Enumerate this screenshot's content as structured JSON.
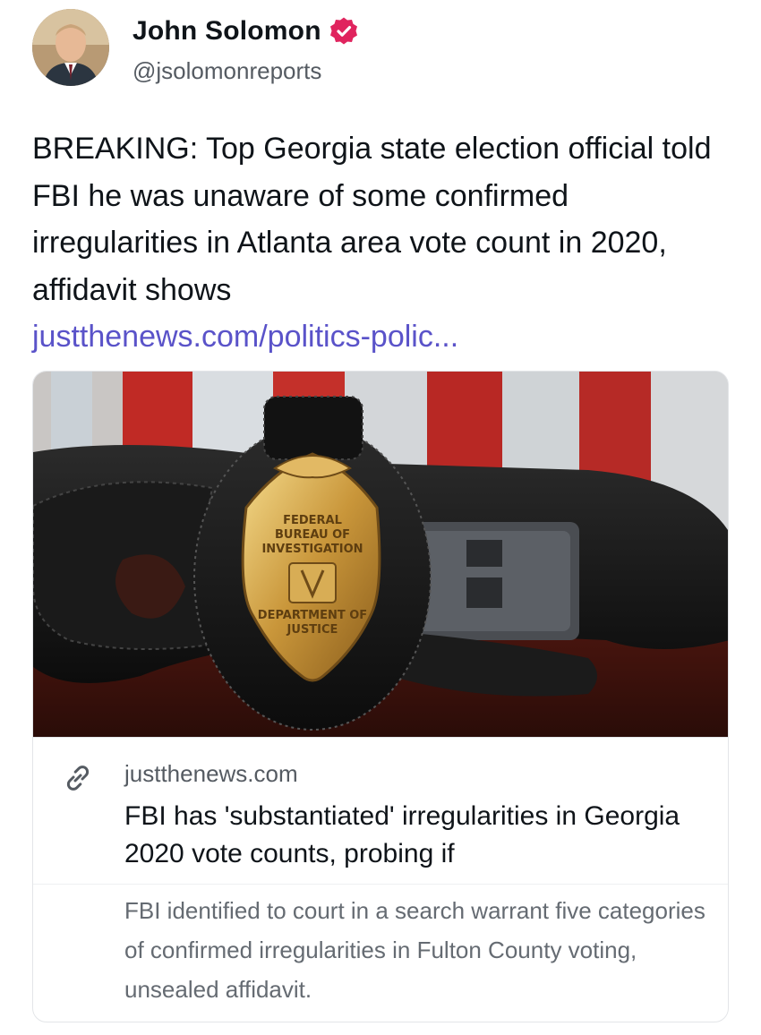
{
  "author": {
    "display_name": "John Solomon",
    "handle": "@jsolomonreports",
    "verified": true,
    "verified_icon": "verified-badge-icon",
    "verified_color": "#e0245e"
  },
  "tweet": {
    "text": "BREAKING: Top Georgia state election official told FBI he was unaware of some confirmed irregularities in Atlanta area vote count in 2020, affidavit shows",
    "link_text": "justthenews.com/politics-polic...",
    "link_color": "#5a53c9"
  },
  "link_card": {
    "image_alt": "FBI badge on a leather holster in front of an American flag",
    "image_badge_lines": [
      "FEDERAL",
      "BUREAU OF",
      "INVESTIGATION",
      "DEPARTMENT OF",
      "JUSTICE"
    ],
    "link_icon": "link-chain-icon",
    "domain": "justthenews.com",
    "title": "FBI has 'substantiated' irregularities in Georgia 2020 vote counts, probing if",
    "description": "FBI identified to court in a search warrant five categories of confirmed irregularities in Fulton County voting, unsealed affidavit."
  }
}
